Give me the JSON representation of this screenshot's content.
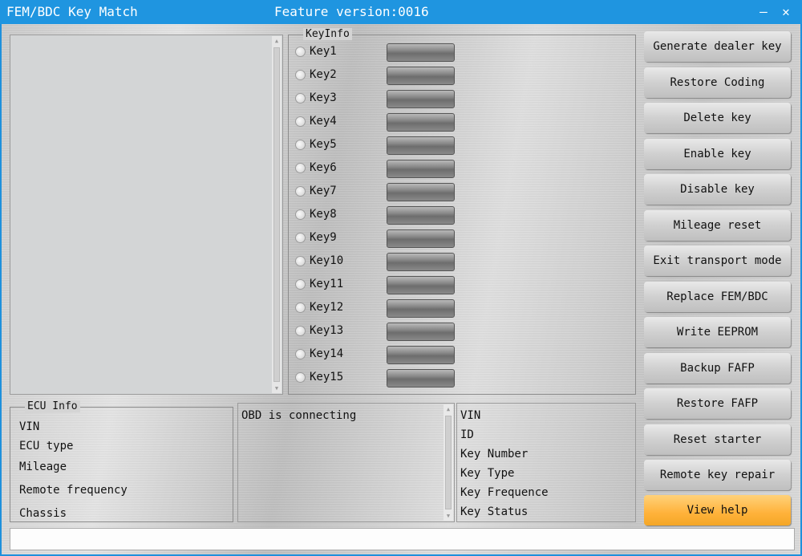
{
  "window": {
    "title": "FEM/BDC Key Match",
    "feature_version": "Feature version:0016",
    "minimize_glyph": "–",
    "close_glyph": "✕"
  },
  "keyinfo": {
    "legend": "KeyInfo",
    "keys": [
      "Key1",
      "Key2",
      "Key3",
      "Key4",
      "Key5",
      "Key6",
      "Key7",
      "Key8",
      "Key9",
      "Key10",
      "Key11",
      "Key12",
      "Key13",
      "Key14",
      "Key15"
    ]
  },
  "actions": [
    "Generate dealer key",
    "Restore Coding",
    "Delete key",
    "Enable key",
    "Disable key",
    "Mileage reset",
    "Exit transport mode",
    "Replace FEM/BDC",
    "Write EEPROM",
    "Backup FAFP",
    "Restore FAFP",
    "Reset starter",
    "Remote key repair",
    "View help"
  ],
  "ecu_info": {
    "legend": "ECU Info",
    "fields": [
      "VIN",
      "ECU type",
      "Mileage",
      "Remote frequency",
      "Chassis"
    ]
  },
  "status": {
    "message": "OBD is connecting"
  },
  "key_detail": {
    "fields": [
      "VIN",
      "ID",
      "Key Number",
      "Key Type",
      "Key Frequence",
      "Key Status"
    ]
  },
  "colors": {
    "titlebar": "#1f95e0",
    "help_button": "#ffb23a"
  }
}
